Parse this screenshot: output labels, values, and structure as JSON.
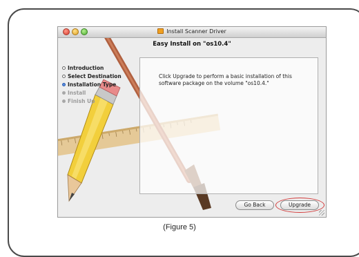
{
  "window": {
    "title": "Install Scanner Driver",
    "subtitle": "Easy Install on \"os10.4\""
  },
  "steps": [
    {
      "label": "Introduction",
      "state": "done"
    },
    {
      "label": "Select Destination",
      "state": "done"
    },
    {
      "label": "Installation Type",
      "state": "current"
    },
    {
      "label": "Install",
      "state": "pending"
    },
    {
      "label": "Finish Up",
      "state": "pending"
    }
  ],
  "content": {
    "message": "Click Upgrade to perform a basic installation of this software package on the volume \"os10.4.\""
  },
  "buttons": {
    "go_back": "Go Back",
    "upgrade": "Upgrade"
  },
  "caption": "(Figure 5)",
  "colors": {
    "highlight_ring": "#d23a3a",
    "current_step_bullet": "#5a8de0"
  },
  "icons": {
    "title_icon": "package-icon",
    "artwork": "pencil-ruler-brush-illustration"
  }
}
